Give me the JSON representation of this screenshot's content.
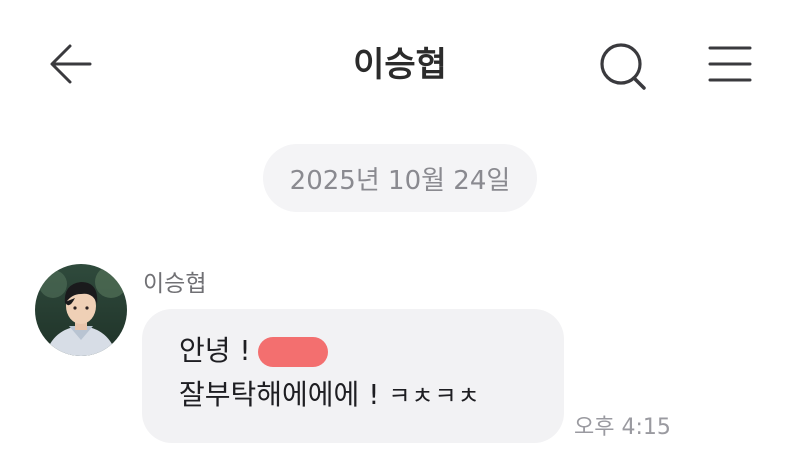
{
  "header": {
    "title": "이승협",
    "back_icon": "arrow-left-icon",
    "search_icon": "search-icon",
    "menu_icon": "hamburger-menu-icon"
  },
  "chat": {
    "date_divider": "2025년 10월 24일",
    "messages": [
      {
        "sender": "이승협",
        "line1": "안녕 !",
        "line2_main": "잘부탁해에에에 ! ",
        "line2_tail": "ㅋㅊㅋㅊ",
        "time": "오후 4:15"
      }
    ]
  },
  "colors": {
    "bubble_bg": "#f2f2f4",
    "date_chip_bg": "#f4f4f6",
    "redaction": "#f36f6f"
  }
}
